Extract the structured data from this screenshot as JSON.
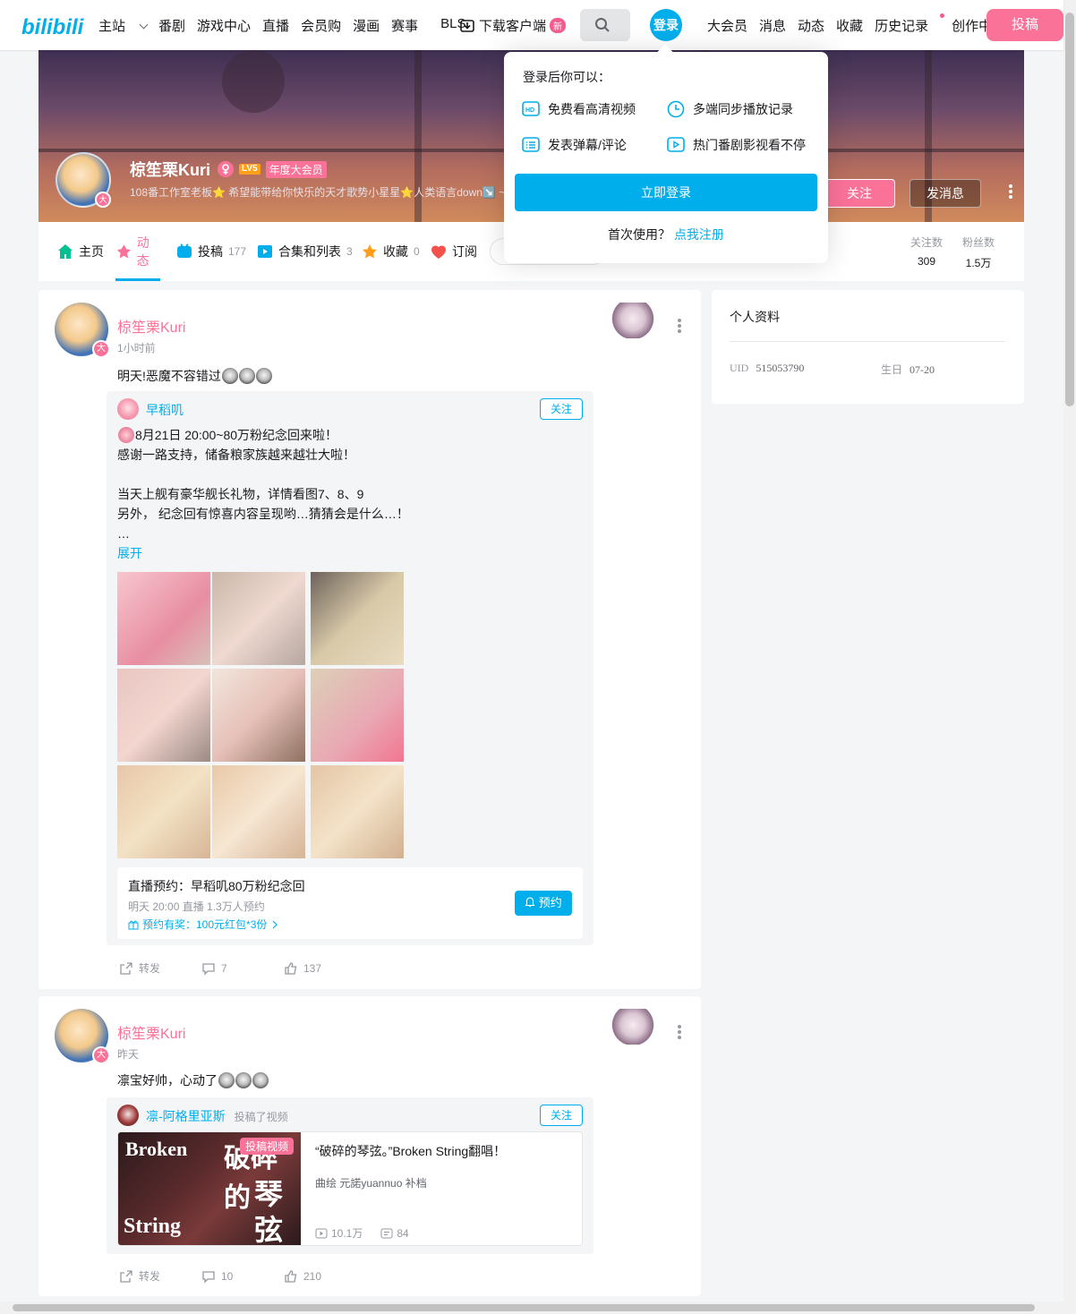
{
  "header": {
    "nav_left": [
      "主站",
      "番剧",
      "游戏中心",
      "直播",
      "会员购",
      "漫画",
      "赛事",
      "BLS"
    ],
    "download": "下载客户端",
    "new_badge": "新",
    "login": "登录",
    "nav_right": [
      "大会员",
      "消息",
      "动态",
      "收藏",
      "历史记录",
      "创作中心"
    ],
    "upload": "投稿"
  },
  "profile_head": {
    "name": "椋笙栗Kuri",
    "level": "LV5",
    "vip": "年度大会员",
    "sign": "108番工作室老板⭐ 希望能带给你快乐的天才歌势小星星⭐人类语言down↘️ ~",
    "follow": "关注",
    "message": "发消息",
    "avatar_badge": "大"
  },
  "tabs": [
    {
      "label": "主页",
      "count": ""
    },
    {
      "label": "动态",
      "count": ""
    },
    {
      "label": "投稿",
      "count": "177"
    },
    {
      "label": "合集和列表",
      "count": "3"
    },
    {
      "label": "收藏",
      "count": "0"
    },
    {
      "label": "订阅",
      "count": ""
    }
  ],
  "stats": {
    "following_label": "关注数",
    "following": "309",
    "fans_label": "粉丝数",
    "fans": "1.5万"
  },
  "login_popup": {
    "title": "登录后你可以：",
    "features": [
      "免费看高清视频",
      "多端同步播放记录",
      "发表弹幕/评论",
      "热门番剧影视看不停"
    ],
    "button": "立即登录",
    "register_prefix": "首次使用？",
    "register_link": "点我注册"
  },
  "post1": {
    "name": "椋笙栗Kuri",
    "time": "1小时前",
    "text": "明天!恶魔不容错过",
    "repost": {
      "name": "早稻叽",
      "follow": "关注",
      "lines": [
        "8月21日 20:00~80万粉纪念回来啦！",
        "感谢一路支持，储备粮家族越来越壮大啦！",
        "",
        "当天上舰有豪华舰长礼物，详情看图7、8、9",
        "另外， 纪念回有惊喜内容呈现哟…猜猜会是什么…！",
        "…"
      ],
      "expand": "展开",
      "live_title": "直播预约：早稻叽80万粉纪念回",
      "live_sub": "明天 20:00 直播 1.3万人预约",
      "live_prize": "预约有奖：100元红包*3份",
      "live_btn": "预约"
    },
    "forward": "转发",
    "comments": "7",
    "likes": "137"
  },
  "post2": {
    "name": "椋笙栗Kuri",
    "time": "昨天",
    "text": "凛宝好帅，心动了",
    "repost": {
      "name": "凛-阿格里亚斯",
      "action": "投稿了视频",
      "follow": "关注",
      "video_badge": "投稿视频",
      "video_title": "“破碎的琴弦。”Broken String翻唱！",
      "video_desc": "曲绘 元諾yuannuo 补档",
      "views": "10.1万",
      "danmaku": "84",
      "cover_en1": "Broken",
      "cover_en2": "String",
      "cover_cn1": "破碎的",
      "cover_cn2": "琴",
      "cover_cn3": "弦"
    },
    "forward": "转发",
    "comments": "10",
    "likes": "210"
  },
  "sidebar": {
    "title": "个人资料",
    "uid_label": "UID",
    "uid": "515053790",
    "birthday_label": "生日",
    "birthday": "07-20"
  },
  "colors": {
    "accent": "#00aeec",
    "pink": "#fb7299"
  }
}
